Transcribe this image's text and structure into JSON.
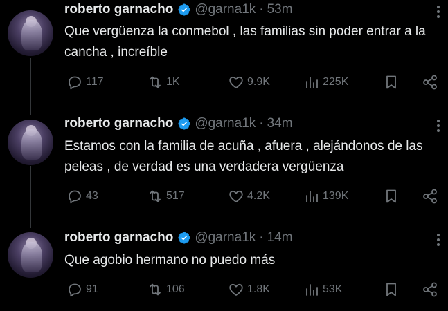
{
  "tweets": [
    {
      "name": "roberto garnacho",
      "handle": "@garna1k",
      "time": "53m",
      "text": "Que vergüenza la conmebol , las familias sin poder entrar a la cancha , increíble",
      "replies": "117",
      "retweets": "1K",
      "likes": "9.9K",
      "views": "225K"
    },
    {
      "name": "roberto garnacho",
      "handle": "@garna1k",
      "time": "34m",
      "text": "Estamos con la familia de acuña , afuera , alejándonos de las peleas , de verdad es una verdadera vergüenza",
      "replies": "43",
      "retweets": "517",
      "likes": "4.2K",
      "views": "139K"
    },
    {
      "name": "roberto garnacho",
      "handle": "@garna1k",
      "time": "14m",
      "text": "Que agobio hermano no puedo más",
      "replies": "91",
      "retweets": "106",
      "likes": "1.8K",
      "views": "53K"
    }
  ],
  "separator": "·",
  "icons": {
    "verified": "verified-badge-icon",
    "more": "more-dots-icon",
    "reply": "reply-icon",
    "retweet": "retweet-icon",
    "like": "heart-icon",
    "views": "views-icon",
    "bookmark": "bookmark-icon",
    "share": "share-icon"
  },
  "colors": {
    "background": "#000000",
    "text": "#e7e9ea",
    "muted": "#71767b",
    "verified": "#1d9bf0",
    "thread_line": "#333639"
  }
}
